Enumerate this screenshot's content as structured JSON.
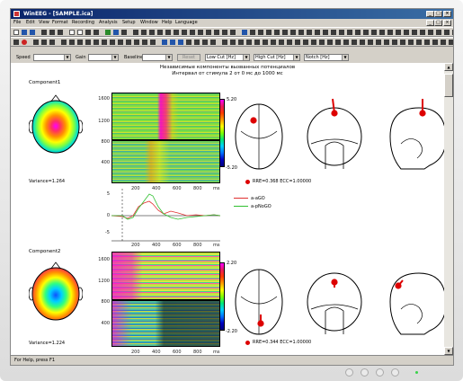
{
  "window": {
    "title": "WinEEG - [SAMPLE.ica]",
    "min_label": "_",
    "max_label": "□",
    "close_label": "×"
  },
  "menu": [
    "File",
    "Edit",
    "View",
    "Format",
    "Recording",
    "Analysis",
    "Setup",
    "Window",
    "Help",
    "Language"
  ],
  "filters": {
    "speed_label": "Speed",
    "gain_label": "Gain",
    "baseline_label": "Baseline",
    "reset_label": "Reset",
    "low_cut_label": "Low Cut [Hz]",
    "high_cut_label": "High Cut [Hz]",
    "notch_label": "Notch [Hz]"
  },
  "header": {
    "line1": "Независимые компоненты вызванных потенциалов",
    "line2": "Интервал от стимула 2 от 0 мс до 1000 мс"
  },
  "components": [
    {
      "name": "Component1",
      "variance": "Variance=1.264",
      "yticks": [
        "1600",
        "1200",
        "800",
        "400"
      ],
      "xticks": [
        "200",
        "400",
        "600",
        "800",
        "ms"
      ],
      "cbar_max": "5.20",
      "cbar_min": "-5.20",
      "rre": "RRE=0.368 ECC=1.00000"
    },
    {
      "name": "Component2",
      "variance": "Variance=1.224",
      "yticks": [
        "1600",
        "1200",
        "800",
        "400"
      ],
      "xticks": [
        "200",
        "400",
        "600",
        "800",
        "ms"
      ],
      "cbar_max": "2.20",
      "cbar_min": "-2.20",
      "rre": "RRE=0.344 ECC=1.00000"
    }
  ],
  "erp": {
    "y_max": "5",
    "y_zero": "0",
    "y_min": "-5",
    "xticks": [
      "200",
      "400",
      "600",
      "800",
      "ms"
    ],
    "legend": [
      "a-aGO",
      "a-pNoGO"
    ],
    "colors": {
      "go": "#e03030",
      "nogo": "#30c030"
    }
  },
  "status": "For Help, press F1"
}
